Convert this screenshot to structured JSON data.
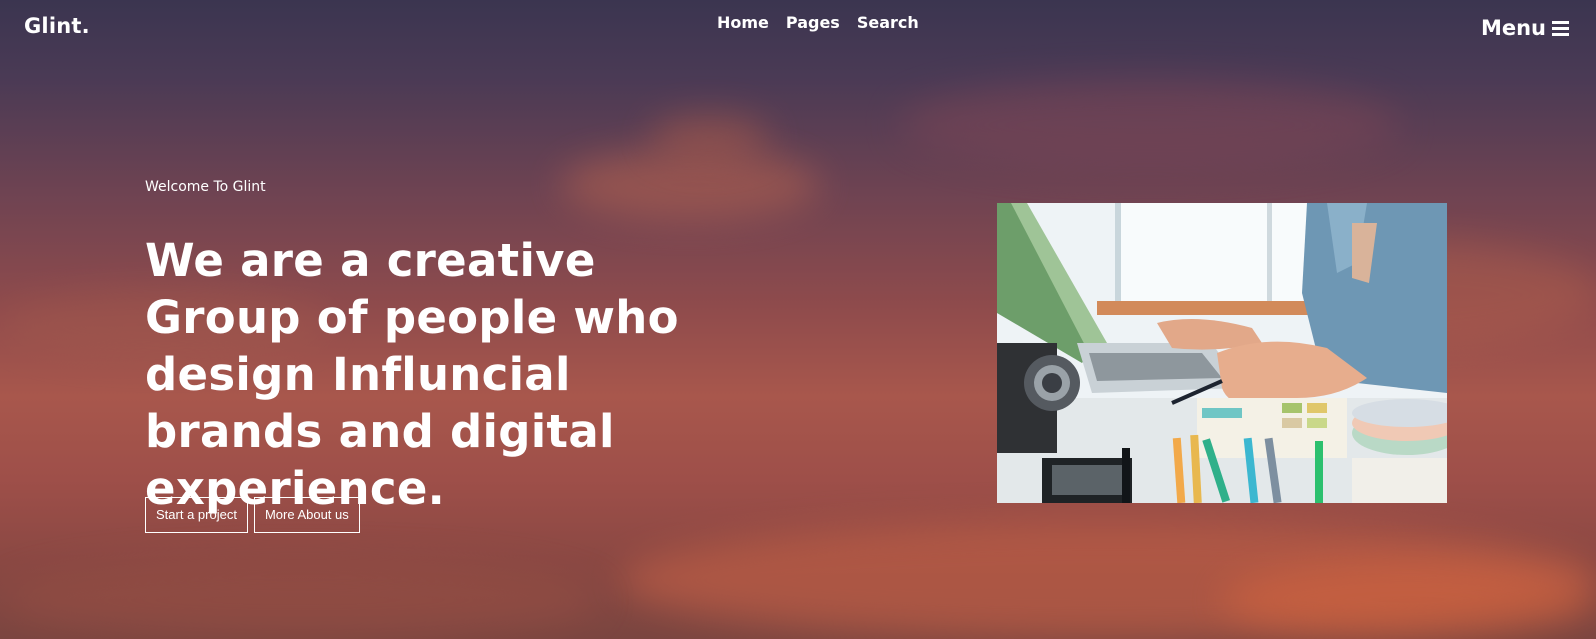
{
  "brand": {
    "logo": "Glint."
  },
  "nav": {
    "items": [
      {
        "label": "Home"
      },
      {
        "label": "Pages"
      },
      {
        "label": "Search"
      }
    ],
    "menu_label": "Menu"
  },
  "hero": {
    "welcome": "Welcome To Glint",
    "headline": "We are a creative Group of people who design Influncial brands and digital experience.",
    "buttons": {
      "start_project": "Start a project",
      "more_about": "More About us"
    },
    "image_icon": "workspace-photo"
  },
  "colors": {
    "sky_top": "#3b3550",
    "sky_bottom": "#c66146",
    "text": "#ffffff"
  }
}
